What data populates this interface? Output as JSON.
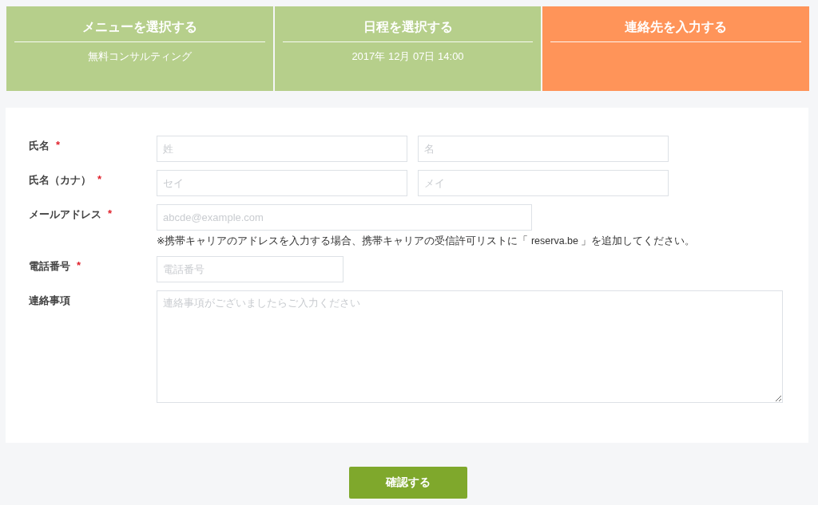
{
  "steps": [
    {
      "title": "メニューを選択する",
      "detail": "無料コンサルティング",
      "selected": false
    },
    {
      "title": "日程を選択する",
      "detail": "2017年 12月 07日 14:00",
      "selected": false
    },
    {
      "title": "連絡先を入力する",
      "selected": true
    }
  ],
  "form": {
    "rows": [
      {
        "label": "氏名",
        "required_mark": "*",
        "inputs": [
          {
            "kind": "half",
            "placeholder": "姓"
          },
          {
            "kind": "half",
            "placeholder": "名"
          }
        ]
      },
      {
        "label": "氏名（カナ）",
        "required_mark": "*",
        "inputs": [
          {
            "kind": "half",
            "placeholder": "セイ"
          },
          {
            "kind": "half",
            "placeholder": "メイ"
          }
        ]
      },
      {
        "label": "メールアドレス",
        "required_mark": "*",
        "inputs": [
          {
            "kind": "wide",
            "placeholder": "abcde@example.com"
          }
        ],
        "note": "※携帯キャリアのアドレスを入力する場合、携帯キャリアの受信許可リストに「 reserva.be 」を追加してください。"
      },
      {
        "label": "電話番号",
        "required_mark": "*",
        "inputs": [
          {
            "kind": "short",
            "placeholder": "電話番号"
          }
        ]
      },
      {
        "label": "連絡事項",
        "inputs": [
          {
            "kind": "textarea",
            "placeholder": "連絡事項がございましたらご入力ください"
          }
        ]
      }
    ]
  },
  "submit": {
    "label": "確認する"
  }
}
